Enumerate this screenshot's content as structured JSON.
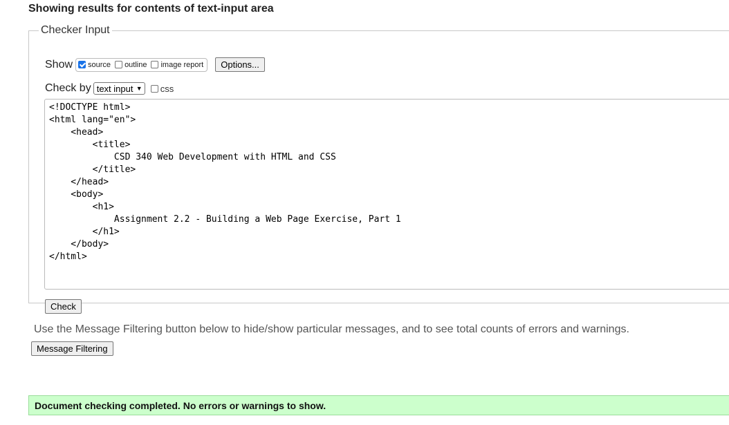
{
  "page": {
    "heading": "Showing results for contents of text-input area"
  },
  "checker": {
    "legend": "Checker Input",
    "show_label": "Show",
    "show_options": [
      {
        "label": "source",
        "checked": true
      },
      {
        "label": "outline",
        "checked": false
      },
      {
        "label": "image report",
        "checked": false
      }
    ],
    "options_button": "Options...",
    "check_by_label": "Check by",
    "check_by_selected": "text input",
    "css_label": "css",
    "css_checked": false,
    "source_text": "<!DOCTYPE html>\n<html lang=\"en\">\n    <head>\n        <title>\n            CSD 340 Web Development with HTML and CSS\n        </title>\n    </head>\n    <body>\n        <h1>\n            Assignment 2.2 - Building a Web Page Exercise, Part 1\n        </h1>\n    </body>\n</html>",
    "check_button": "Check"
  },
  "filtering": {
    "info_text": "Use the Message Filtering button below to hide/show particular messages, and to see total counts of errors and warnings.",
    "button": "Message Filtering"
  },
  "result": {
    "message": "Document checking completed. No errors or warnings to show."
  },
  "colors": {
    "success_bg": "#ccffcc",
    "checkbox_checked": "#1a73e8"
  }
}
